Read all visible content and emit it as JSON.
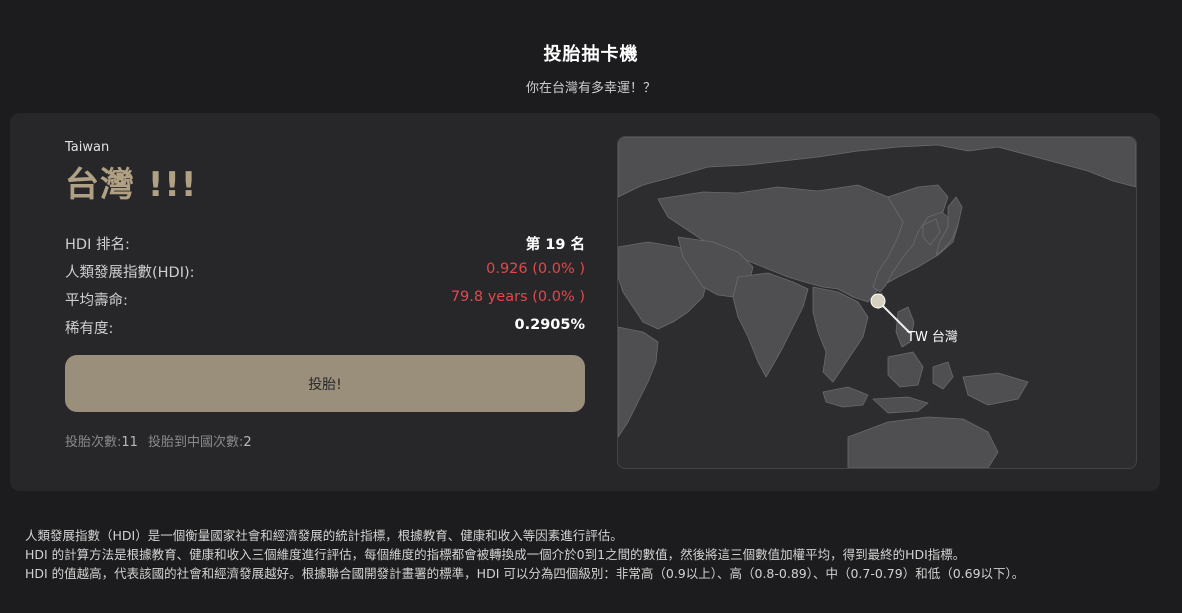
{
  "header": {
    "title": "投胎抽卡機",
    "subtitle": "你在台灣有多幸運！？"
  },
  "result": {
    "country_en": "Taiwan",
    "country_zh": "台灣 !!!",
    "stats": [
      {
        "label": "HDI 排名:",
        "value": "第 19 名"
      },
      {
        "label": "人類發展指數(HDI):",
        "value": "0.926 (0.0% )"
      },
      {
        "label": "平均壽命:",
        "value": "79.8 years (0.0% )"
      },
      {
        "label": "稀有度:",
        "value": "0.2905%"
      }
    ],
    "button_label": "投胎!",
    "count_label": "投胎次數:",
    "count_value": "11",
    "china_count_label": "投胎到中國次數:",
    "china_count_value": "2"
  },
  "map": {
    "marker_label": "TW 台灣",
    "land_color": "#4f4f52",
    "ocean_color": "#2d2d30",
    "marker_color": "#d8d0bf"
  },
  "footer": {
    "lines": [
      "人類發展指數（HDI）是一個衡量國家社會和經濟發展的統計指標，根據教育、健康和收入等因素進行評估。",
      "HDI 的計算方法是根據教育、健康和收入三個維度進行評估，每個維度的指標都會被轉換成一個介於0到1之間的數值，然後將這三個數值加權平均，得到最終的HDI指標。",
      "HDI 的值越高，代表該國的社會和經濟發展越好。根據聯合國開發計畫署的標準，HDI 可以分為四個級別：非常高（0.9以上）、高（0.8-0.89）、中（0.7-0.79）和低（0.69以下）。"
    ]
  }
}
